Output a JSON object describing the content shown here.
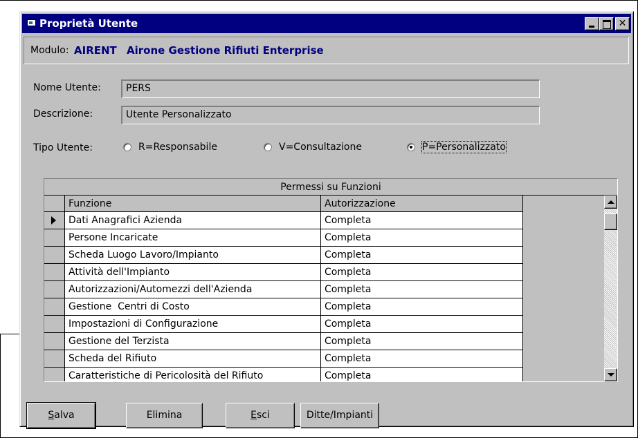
{
  "window": {
    "title": "Proprietà Utente",
    "controls": {
      "minimize": "minimize",
      "maximize": "maximize",
      "close": "✕"
    }
  },
  "modulo": {
    "label": "Modulo:",
    "code": "AIRENT",
    "name": "Airone Gestione Rifiuti Enterprise"
  },
  "form": {
    "nome_utente_label": "Nome Utente:",
    "nome_utente_value": "PERS",
    "descrizione_label": "Descrizione:",
    "descrizione_value": "Utente Personalizzato",
    "tipo_utente_label": "Tipo Utente:",
    "tipo_options": [
      {
        "label": "R=Responsabile",
        "selected": false
      },
      {
        "label": "V=Consultazione",
        "selected": false
      },
      {
        "label": "P=Personalizzato",
        "selected": true
      }
    ]
  },
  "grid": {
    "caption": "Permessi su Funzioni",
    "columns": [
      "Funzione",
      "Autorizzazione"
    ],
    "rows": [
      {
        "funzione": "Dati Anagrafici Azienda",
        "autorizzazione": "Completa",
        "current": true
      },
      {
        "funzione": "Persone Incaricate",
        "autorizzazione": "Completa"
      },
      {
        "funzione": "Scheda Luogo Lavoro/Impianto",
        "autorizzazione": "Completa"
      },
      {
        "funzione": "Attività dell'Impianto",
        "autorizzazione": "Completa"
      },
      {
        "funzione": "Autorizzazioni/Automezzi dell'Azienda",
        "autorizzazione": "Completa"
      },
      {
        "funzione": "Gestione  Centri di Costo",
        "autorizzazione": "Completa"
      },
      {
        "funzione": "Impostazioni di Configurazione",
        "autorizzazione": "Completa"
      },
      {
        "funzione": "Gestione del Terzista",
        "autorizzazione": "Completa"
      },
      {
        "funzione": "Scheda del Rifiuto",
        "autorizzazione": "Completa"
      },
      {
        "funzione": "Caratteristiche di Pericolosità del Rifiuto",
        "autorizzazione": "Completa"
      }
    ]
  },
  "buttons": {
    "salva": "Salva",
    "elimina": "Elimina",
    "esci": "Esci",
    "ditte": "Ditte/Impianti"
  },
  "colors": {
    "title_bar": "#000080",
    "face": "#c0c0c0",
    "modulo_text": "#000080"
  }
}
